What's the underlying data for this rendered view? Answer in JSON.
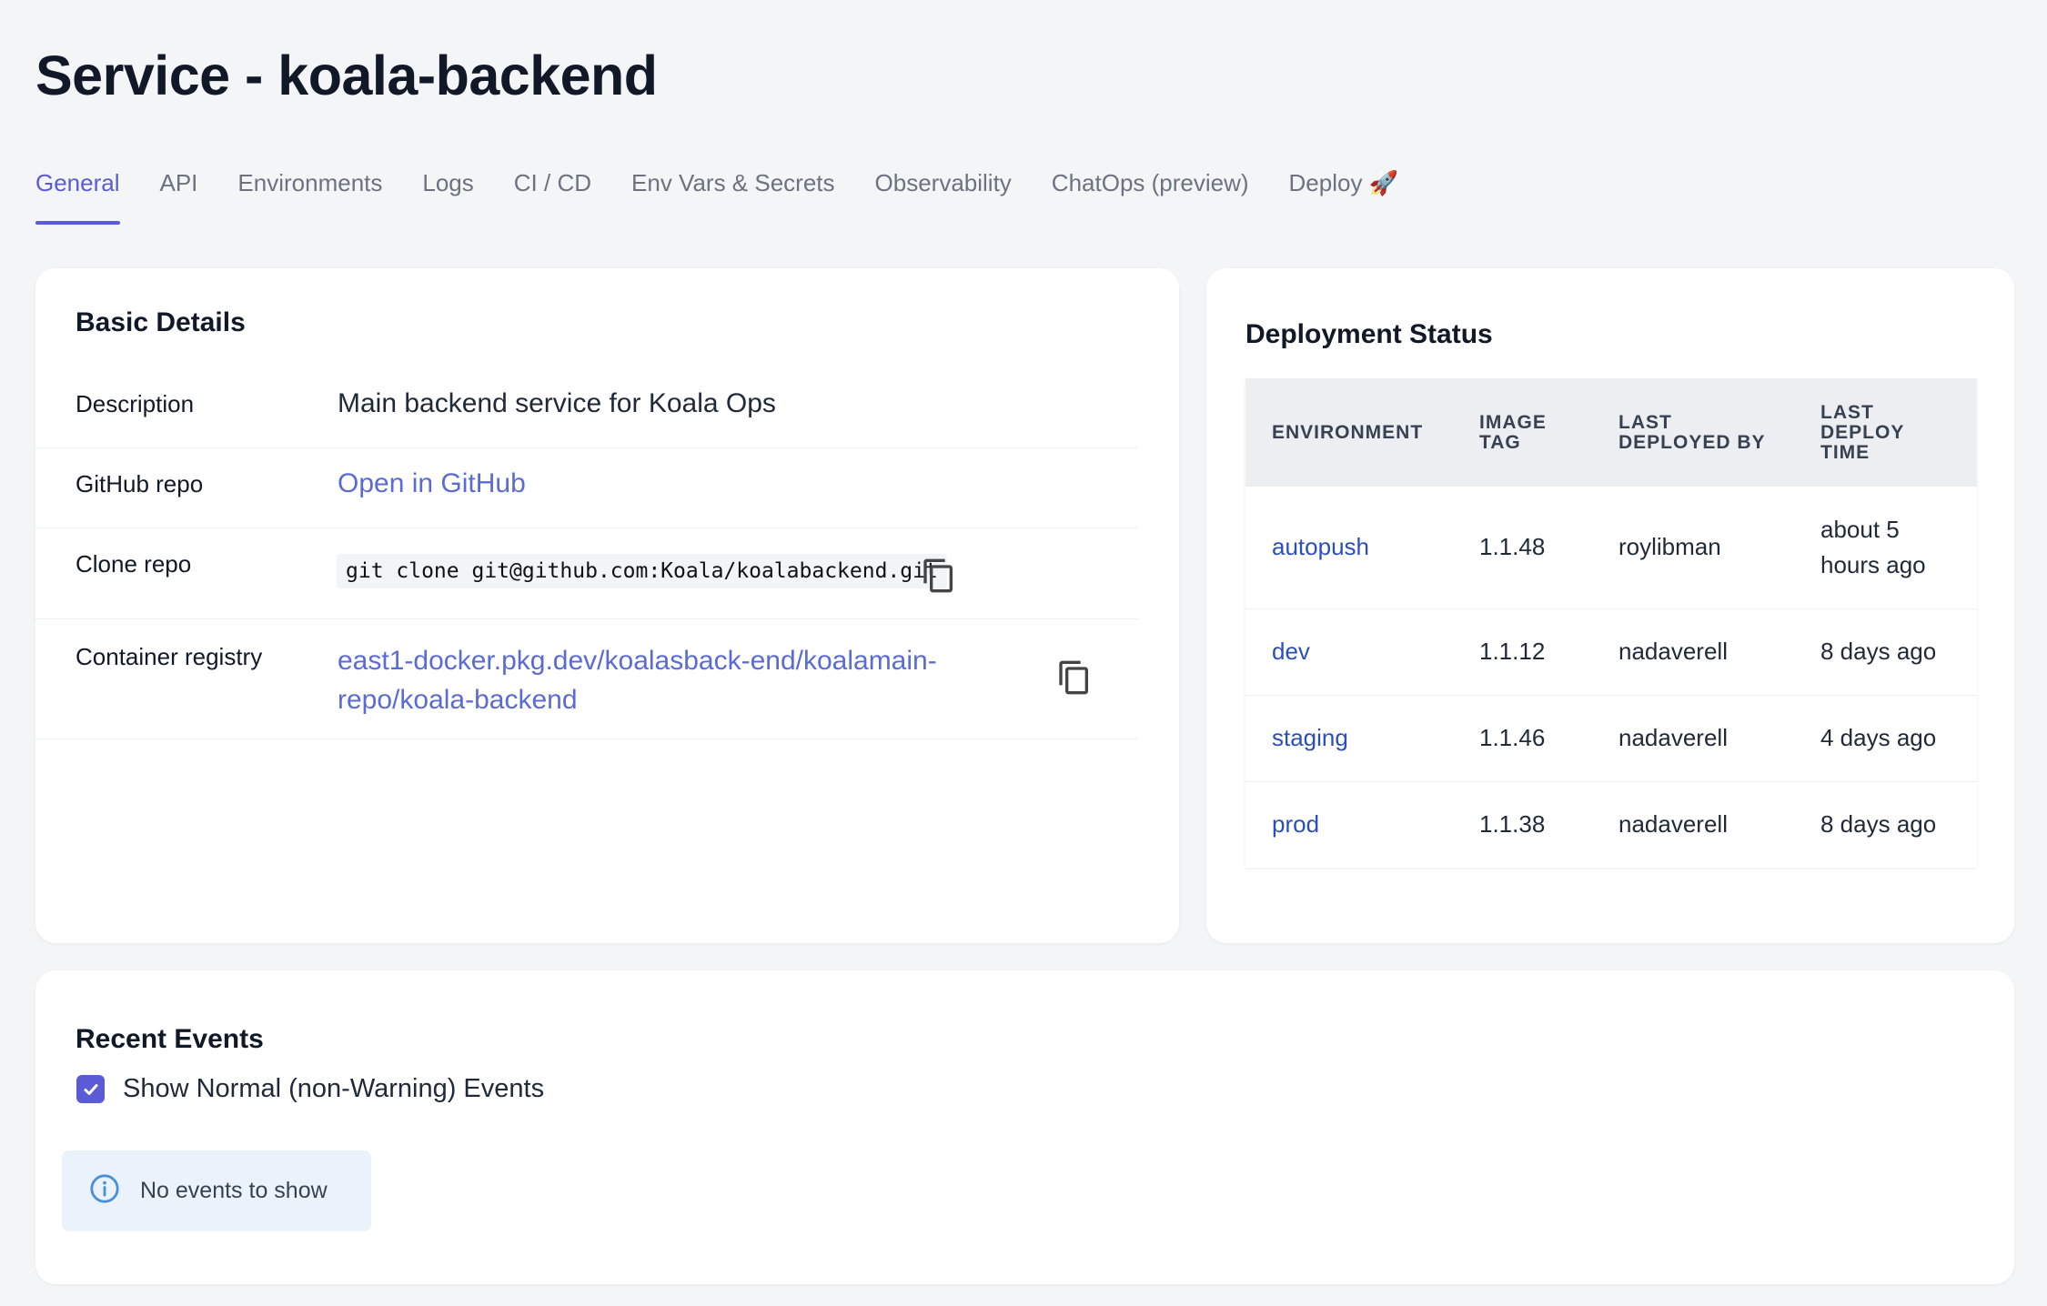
{
  "page": {
    "title": "Service - koala-backend"
  },
  "tabs": [
    {
      "label": "General",
      "active": true
    },
    {
      "label": "API"
    },
    {
      "label": "Environments"
    },
    {
      "label": "Logs"
    },
    {
      "label": "CI / CD"
    },
    {
      "label": "Env Vars & Secrets"
    },
    {
      "label": "Observability"
    },
    {
      "label": "ChatOps (preview)"
    },
    {
      "label": "Deploy 🚀"
    }
  ],
  "basic_details": {
    "title": "Basic Details",
    "description_label": "Description",
    "description_value": "Main backend service for Koala Ops",
    "github_label": "GitHub repo",
    "github_link": "Open in GitHub",
    "clone_label": "Clone repo",
    "clone_command": "git clone git@github.com:Koala/koalabackend.git",
    "registry_label": "Container registry",
    "registry_line1": "east1-docker.pkg.dev/koalasback-end/koalamain-",
    "registry_line2": "repo/koala-backend"
  },
  "deployment_status": {
    "title": "Deployment Status",
    "headers": {
      "environment": "ENVIRONMENT",
      "image_tag_1": "IMAGE",
      "image_tag_2": "TAG",
      "deployed_by_1": "LAST",
      "deployed_by_2": "DEPLOYED BY",
      "deploy_time_1": "LAST",
      "deploy_time_2": "DEPLOY",
      "deploy_time_3": "TIME"
    },
    "rows": [
      {
        "env": "autopush",
        "tag": "1.1.48",
        "by": "roylibman",
        "time_1": "about 5",
        "time_2": "hours ago"
      },
      {
        "env": "dev",
        "tag": "1.1.12",
        "by": "nadaverell",
        "time_1": "8 days ago",
        "time_2": ""
      },
      {
        "env": "staging",
        "tag": "1.1.46",
        "by": "nadaverell",
        "time_1": "4 days ago",
        "time_2": ""
      },
      {
        "env": "prod",
        "tag": "1.1.38",
        "by": "nadaverell",
        "time_1": "8 days ago",
        "time_2": ""
      }
    ]
  },
  "recent_events": {
    "title": "Recent Events",
    "checkbox_label": "Show Normal (non-Warning) Events",
    "checkbox_checked": true,
    "empty_message": "No events to show"
  },
  "colors": {
    "accent": "#5b5bd6",
    "link": "#5b6bd6",
    "env_link": "#2b4fb8",
    "background": "#f4f5f7",
    "info_bg": "#eaf3fb"
  },
  "icons": {
    "copy": "copy-icon",
    "check": "check-icon",
    "info": "info-icon"
  }
}
